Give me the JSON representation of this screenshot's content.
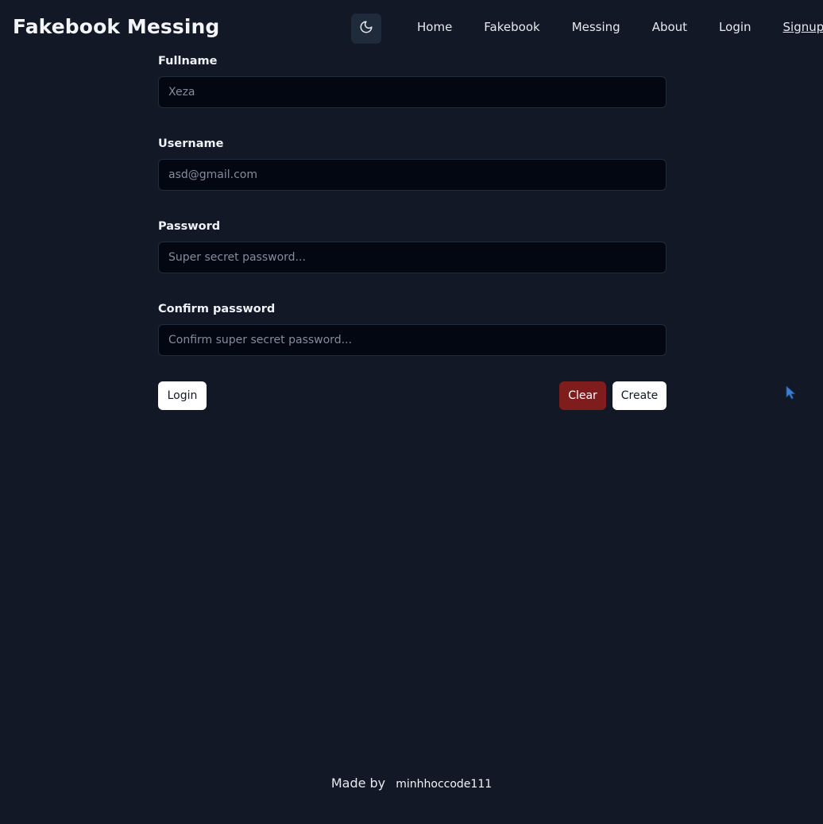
{
  "brand": "Fakebook Messing",
  "theme_toggle": {
    "icon": "moon-icon"
  },
  "nav": [
    {
      "label": "Home"
    },
    {
      "label": "Fakebook"
    },
    {
      "label": "Messing"
    },
    {
      "label": "About"
    },
    {
      "label": "Login"
    },
    {
      "label": "Signup",
      "active": true
    }
  ],
  "form": {
    "fullname": {
      "label": "Fullname",
      "value": "",
      "placeholder": "Xeza"
    },
    "username": {
      "label": "Username",
      "value": "",
      "placeholder": "asd@gmail.com"
    },
    "password": {
      "label": "Password",
      "value": "",
      "placeholder": "Super secret password..."
    },
    "confirm_password": {
      "label": "Confirm password",
      "value": "",
      "placeholder": "Confirm super secret password..."
    }
  },
  "actions": {
    "login_label": "Login",
    "clear_label": "Clear",
    "create_label": "Create"
  },
  "footer": {
    "made_by": "Made by",
    "author": "minhhoccode111"
  },
  "colors": {
    "background": "#121826",
    "input_bg": "#030712",
    "clear_button": "#7f1d1d",
    "primary_button": "#ffffff"
  }
}
